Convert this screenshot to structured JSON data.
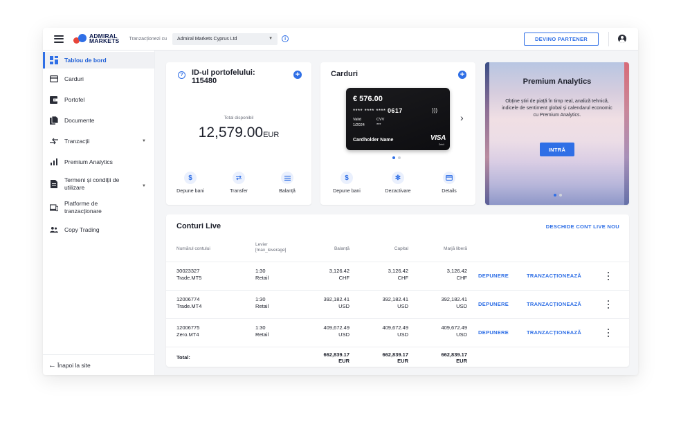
{
  "header": {
    "brand_line1": "ADMIRAL",
    "brand_line2": "MARKETS",
    "trade_with_label": "Tranzacționezi cu",
    "entity_selected": "Admiral Markets Cyprus Ltd",
    "partner_button": "DEVINO PARTENER"
  },
  "sidebar": {
    "items": [
      {
        "label": "Tablou de bord",
        "icon": "dashboard-icon"
      },
      {
        "label": "Carduri",
        "icon": "card-icon"
      },
      {
        "label": "Portofel",
        "icon": "wallet-icon"
      },
      {
        "label": "Documente",
        "icon": "documents-icon"
      },
      {
        "label": "Tranzacții",
        "icon": "transactions-icon"
      },
      {
        "label": "Premium Analytics",
        "icon": "analytics-icon"
      },
      {
        "label": "Termeni și condiții de utilizare",
        "icon": "terms-icon"
      },
      {
        "label": "Platforme de tranzacționare",
        "icon": "platforms-icon"
      },
      {
        "label": "Copy Trading",
        "icon": "copy-trading-icon"
      }
    ],
    "back_link": "Înapoi la site"
  },
  "wallet": {
    "title": "ID-ul portofelului: 115480",
    "available_label": "Total disponibil",
    "available_value": "12,579.00",
    "currency": "EUR",
    "actions": [
      {
        "label": "Depune bani",
        "icon": "dollar-icon"
      },
      {
        "label": "Transfer",
        "icon": "transfer-icon"
      },
      {
        "label": "Balanță",
        "icon": "list-icon"
      }
    ]
  },
  "cards": {
    "title": "Carduri",
    "card_balance": "€ 576.00",
    "card_number_masked": "**** **** ****",
    "card_last4": "0617",
    "valid_label": "Valid",
    "valid_date": "1/2024",
    "cvv_label": "CVV",
    "cvv_value": "***",
    "holder": "Cardholder Name",
    "network": "VISA",
    "network_sub": "Debit",
    "actions": [
      {
        "label": "Depune bani",
        "icon": "dollar-icon"
      },
      {
        "label": "Dezactivare",
        "icon": "snowflake-icon"
      },
      {
        "label": "Details",
        "icon": "card-icon"
      }
    ]
  },
  "promo": {
    "title": "Premium Analytics",
    "text": "Obține știri de piață în timp real, analiză tehnică, indicele de sentiment global și calendarul economic cu Premium Analytics.",
    "button": "INTRĂ"
  },
  "accounts": {
    "title": "Conturi Live",
    "open_new": "DESCHIDE CONT LIVE NOU",
    "headers": {
      "account": "Numărul contului",
      "leverage": "Levier",
      "leverage_sub": "[max_leverage]",
      "balance": "Balanță",
      "equity": "Capital",
      "free_margin": "Marjă liberă"
    },
    "deposit_label": "DEPUNERE",
    "trade_label": "TRANZACȚIONEAZĂ",
    "rows": [
      {
        "number": "30023327",
        "platform": "Trade.MT5",
        "leverage": "1:30",
        "type": "Retail",
        "balance": "3,126.42",
        "equity": "3,126.42",
        "free_margin": "3,126.42",
        "currency": "CHF"
      },
      {
        "number": "12006774",
        "platform": "Trade.MT4",
        "leverage": "1:30",
        "type": "Retail",
        "balance": "392,182.41",
        "equity": "392,182.41",
        "free_margin": "392,182.41",
        "currency": "USD"
      },
      {
        "number": "12006775",
        "platform": "Zero.MT4",
        "leverage": "1:30",
        "type": "Retail",
        "balance": "409,672.49",
        "equity": "409,672.49",
        "free_margin": "409,672.49",
        "currency": "USD"
      }
    ],
    "total": {
      "label": "Total:",
      "balance": "662,839.17",
      "equity": "662,839.17",
      "free_margin": "662,839.17",
      "currency": "EUR"
    }
  },
  "colors": {
    "accent": "#2f6fe6",
    "text": "#1c1f2a",
    "background": "#f4f5f7"
  }
}
